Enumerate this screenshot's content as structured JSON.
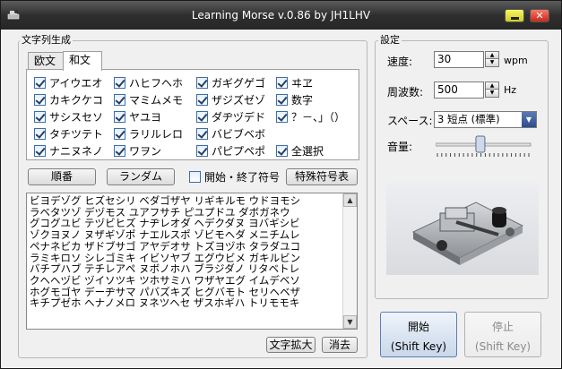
{
  "window": {
    "title": "Learning Morse v.0.86 by JH1LHV",
    "close_label": "✕"
  },
  "gen_group": {
    "label": "文字列生成",
    "tabs": [
      "欧文",
      "和文"
    ],
    "checkboxes": [
      {
        "label": "アイウエオ",
        "checked": true
      },
      {
        "label": "カキクケコ",
        "checked": true
      },
      {
        "label": "サシスセソ",
        "checked": true
      },
      {
        "label": "タチツテト",
        "checked": true
      },
      {
        "label": "ナニヌネノ",
        "checked": true
      },
      {
        "label": "ハヒフヘホ",
        "checked": true
      },
      {
        "label": "マミムメモ",
        "checked": true
      },
      {
        "label": "ヤユヨ",
        "checked": true
      },
      {
        "label": "ラリルレロ",
        "checked": true
      },
      {
        "label": "ワヲン",
        "checked": true
      },
      {
        "label": "ガギグゲゴ",
        "checked": true
      },
      {
        "label": "ザジズゼゾ",
        "checked": true
      },
      {
        "label": "ダヂヅデド",
        "checked": true
      },
      {
        "label": "バビブベボ",
        "checked": true
      },
      {
        "label": "パピプペポ",
        "checked": true
      },
      {
        "label": "ヰヱ",
        "checked": true
      },
      {
        "label": "数字",
        "checked": true
      },
      {
        "label": "？－、」（）",
        "checked": true
      },
      {
        "label": "全選択",
        "checked": true
      }
    ],
    "order_button": "順番",
    "random_button": "ランダム",
    "startend_label": "開始・終了符号",
    "startend_checked": false,
    "special_button": "特殊符号表",
    "text_lines": [
      "ビヨデゾグ ヒズセシリ ベダゴザヤ リギキルモ ウドヨモシ",
      "ラベタツゾ デヅモス ユアフサチ ピユプドユ ダボガネウ",
      "グコグユビ テヅビヒズ ナヂレオダ ヘデクダヌ ヨバギシビ",
      "ゾクヨヌノ ヌザギゾポ ナエルスポ ゾビモヘダ メニチムレ",
      "ペナネビカ ザドブサゴ アヤデオサ トズヨヅホ タラダユコ",
      "ラミキロソ シレゴミキ イビソヤブ エグウビメ ガキルビン",
      "バチプハブ テチレアペ ヌボノホハ ブラジダノ リタベトレ",
      "クヘヘヅビ ヅイソツキ ツホサミハ ワザヤエグ イムデベソ",
      "ホグモゴヤ デーヂサマ パバズキズ ヒグバモト セリヘベザ",
      "キチプゼホ ヘナノメロ ヌネツヘセ ザスホギハ トリモモキ"
    ],
    "enlarge_button": "文字拡大",
    "clear_button": "消去"
  },
  "settings": {
    "label": "設定",
    "speed_label": "速度:",
    "speed_value": "30",
    "speed_unit": "wpm",
    "freq_label": "周波数:",
    "freq_value": "500",
    "freq_unit": "Hz",
    "space_label": "スペース:",
    "space_value": "3 短点 (標準)",
    "volume_label": "音量:",
    "volume_level": 0.47
  },
  "start_button": {
    "label": "開始",
    "hint": "(Shift Key)"
  },
  "stop_button": {
    "label": "停止",
    "hint": "(Shift Key)"
  }
}
